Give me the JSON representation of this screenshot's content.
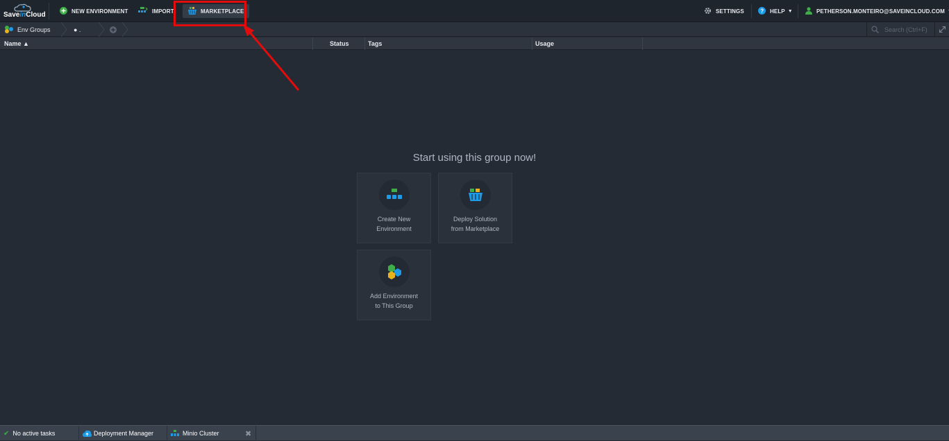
{
  "topbar": {
    "logo_save": "Save",
    "logo_in": "in",
    "logo_cloud": "Cloud",
    "new_environment": "NEW ENVIRONMENT",
    "import": "IMPORT",
    "marketplace": "MARKETPLACE",
    "settings": "SETTINGS",
    "help": "HELP",
    "user": "PETHERSON.MONTEIRO@SAVEINCLOUD.COM"
  },
  "breadcrumb": {
    "env_groups": "Env Groups",
    "current": "●  ."
  },
  "search": {
    "placeholder": "Search (Ctrl+F)"
  },
  "table": {
    "columns": [
      "Name ▲",
      "Status",
      "Tags",
      "Usage"
    ]
  },
  "empty_state": {
    "title": "Start using this group now!",
    "cards": [
      {
        "line1": "Create New",
        "line2": "Environment"
      },
      {
        "line1": "Deploy Solution",
        "line2": "from Marketplace"
      },
      {
        "line1": "Add Environment",
        "line2": "to This Group"
      }
    ]
  },
  "bottombar": {
    "tasks": "No active tasks",
    "deployment_manager": "Deployment Manager",
    "minio": "Minio Cluster"
  },
  "colors": {
    "accent": "#1e9be8",
    "highlight": "#e30c0c",
    "green": "#3fae49"
  }
}
